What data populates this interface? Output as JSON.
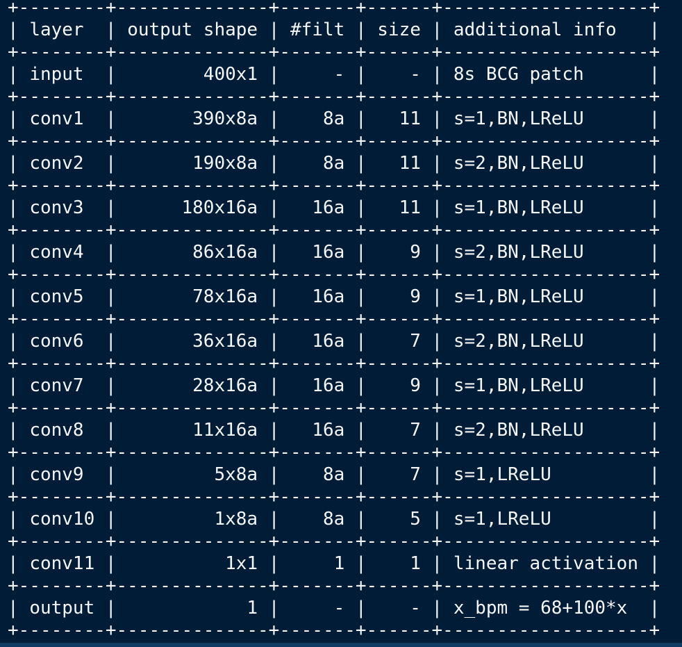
{
  "table": {
    "columns": [
      "layer",
      "output shape",
      "#filt",
      "size",
      "additional info"
    ],
    "rows": [
      [
        "input",
        "400x1",
        "-",
        "-",
        "8s BCG patch"
      ],
      [
        "conv1",
        "390x8a",
        "8a",
        "11",
        "s=1,BN,LReLU"
      ],
      [
        "conv2",
        "190x8a",
        "8a",
        "11",
        "s=2,BN,LReLU"
      ],
      [
        "conv3",
        "180x16a",
        "16a",
        "11",
        "s=1,BN,LReLU"
      ],
      [
        "conv4",
        "86x16a",
        "16a",
        "9",
        "s=2,BN,LReLU"
      ],
      [
        "conv5",
        "78x16a",
        "16a",
        "9",
        "s=1,BN,LReLU"
      ],
      [
        "conv6",
        "36x16a",
        "16a",
        "7",
        "s=2,BN,LReLU"
      ],
      [
        "conv7",
        "28x16a",
        "16a",
        "9",
        "s=1,BN,LReLU"
      ],
      [
        "conv8",
        "11x16a",
        "16a",
        "7",
        "s=2,BN,LReLU"
      ],
      [
        "conv9",
        "5x8a",
        "8a",
        "7",
        "s=1,LReLU"
      ],
      [
        "conv10",
        "1x8a",
        "8a",
        "5",
        "s=1,LReLU"
      ],
      [
        "conv11",
        "1x1",
        "1",
        "1",
        "linear activation"
      ],
      [
        "output",
        "1",
        "-",
        "-",
        "x_bpm = 68+100*x"
      ]
    ]
  },
  "colors": {
    "background": "#011c36",
    "text": "#f4f6f8",
    "bottom_strip": "#0e3a63"
  }
}
